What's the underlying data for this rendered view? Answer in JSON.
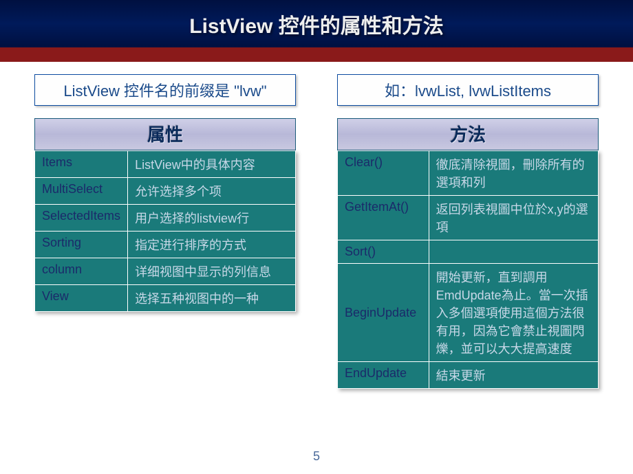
{
  "title": "ListView 控件的属性和方法",
  "left": {
    "caption": "ListView 控件名的前缀是 \"lvw\"",
    "header": "属性",
    "rows": [
      {
        "name": "Items",
        "desc": "ListView中的具体内容"
      },
      {
        "name": "MultiSelect",
        "desc": "允许选择多个项"
      },
      {
        "name": "SelectedItems",
        "desc": "用户选择的listview行"
      },
      {
        "name": "Sorting",
        "desc": "指定进行排序的方式"
      },
      {
        "name": "column",
        "desc": "详细视图中显示的列信息"
      },
      {
        "name": "View",
        "desc": "选择五种视图中的一种"
      }
    ]
  },
  "right": {
    "caption": "如：lvwList, lvwListItems",
    "header": "方法",
    "rows": [
      {
        "name": "Clear()",
        "desc": "徹底清除視圖，刪除所有的選項和列"
      },
      {
        "name": "GetItemAt()",
        "desc": "返回列表視圖中位於x,y的選項"
      },
      {
        "name": "Sort()",
        "desc": ""
      },
      {
        "name": "BeginUpdate",
        "desc": "開始更新，直到調用EmdUpdate為止。當一次插入多個選項使用這個方法很有用，因為它會禁止視圖閃爍，並可以大大提高速度"
      },
      {
        "name": "EndUpdate",
        "desc": "結束更新"
      }
    ]
  },
  "page_number": "5"
}
